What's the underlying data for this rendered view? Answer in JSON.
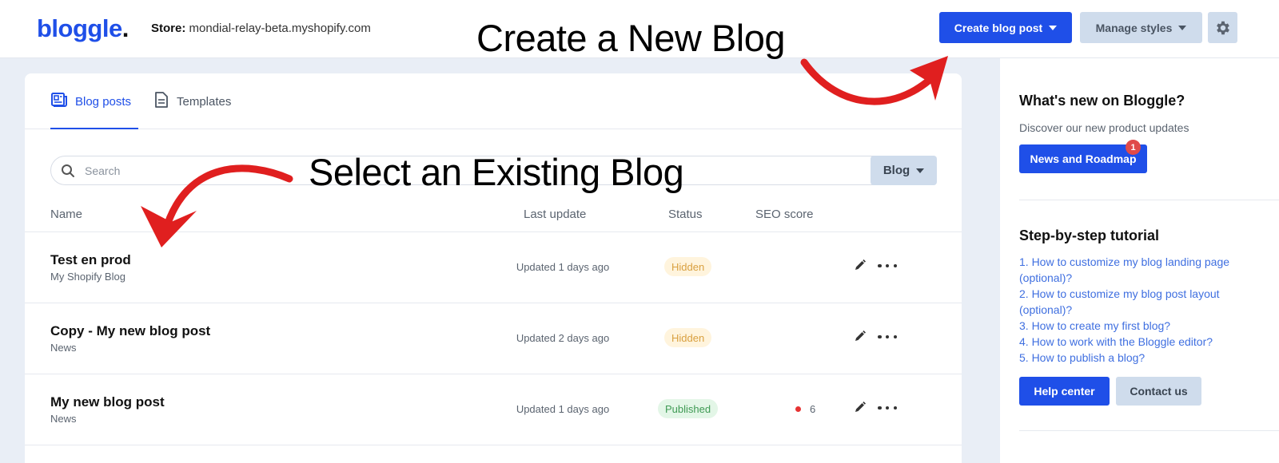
{
  "app": {
    "logo_text": "bloggle",
    "logo_dot": ".",
    "store_label": "Store:",
    "store_value": "mondial-relay-beta.myshopify.com"
  },
  "header": {
    "create_button": "Create blog post",
    "manage_button": "Manage styles",
    "settings_icon": "gear-icon"
  },
  "annotations": {
    "create_new": "Create a New Blog",
    "select_existing": "Select an Existing Blog"
  },
  "tabs": [
    {
      "label": "Blog posts",
      "icon": "newspaper-icon",
      "active": true
    },
    {
      "label": "Templates",
      "icon": "document-icon",
      "active": false
    }
  ],
  "search": {
    "placeholder": "Search",
    "filter_label": "Blog"
  },
  "table": {
    "columns": [
      "Name",
      "Last update",
      "Status",
      "SEO score"
    ],
    "rows": [
      {
        "title": "Test en prod",
        "blog": "My Shopify Blog",
        "updated": "Updated 1 days ago",
        "status": "Hidden",
        "seo": ""
      },
      {
        "title": "Copy - My new blog post",
        "blog": "News",
        "updated": "Updated 2 days ago",
        "status": "Hidden",
        "seo": ""
      },
      {
        "title": "My new blog post",
        "blog": "News",
        "updated": "Updated 1 days ago",
        "status": "Published",
        "seo": "6"
      }
    ]
  },
  "sidebar": {
    "whats_new_title": "What's new on Bloggle?",
    "whats_new_desc": "Discover our new product updates",
    "news_button": "News and Roadmap",
    "news_badge": "1",
    "tutorial_title": "Step-by-step tutorial",
    "tutorial_links": [
      "1. How to customize my blog landing page (optional)?",
      "2. How to customize my blog post layout (optional)?",
      "3. How to create my first blog?",
      "4. How to work with the Bloggle editor?",
      "5. How to publish a blog?"
    ],
    "help_button": "Help center",
    "contact_button": "Contact us"
  },
  "colors": {
    "primary": "#1f4fe8",
    "secondary_button": "#cfdcec",
    "hidden_badge_bg": "#fff4dd",
    "published_badge_bg": "#e3f6e7",
    "annotation_arrow": "#e01f1f"
  }
}
